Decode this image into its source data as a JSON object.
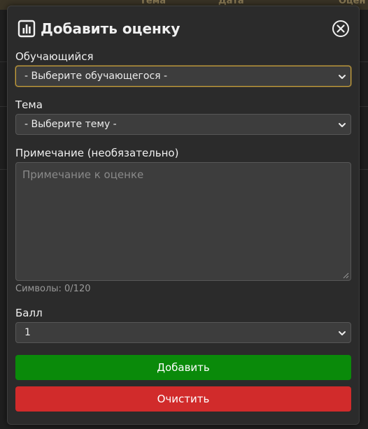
{
  "background": {
    "columns": [
      "Тема",
      "Дата",
      "Оцен"
    ]
  },
  "modal": {
    "title": "Добавить оценку",
    "title_icon": "bar-chart-icon",
    "close_icon": "close-circle-icon"
  },
  "fields": {
    "student": {
      "label": "Обучающийся",
      "selected": "- Выберите обучающегося -"
    },
    "topic": {
      "label": "Тема",
      "selected": "- Выберите тему -"
    },
    "note": {
      "label": "Примечание (необязательно)",
      "placeholder": "Примечание к оценке",
      "counter": "Символы: 0/120"
    },
    "score": {
      "label": "Балл",
      "selected": "1"
    }
  },
  "buttons": {
    "add": "Добавить",
    "clear": "Очистить"
  },
  "colors": {
    "accent_focus": "#c9a13b",
    "add_button": "#0a8a0a",
    "clear_button": "#d12b2b",
    "modal_bg": "#2b2b2b"
  }
}
